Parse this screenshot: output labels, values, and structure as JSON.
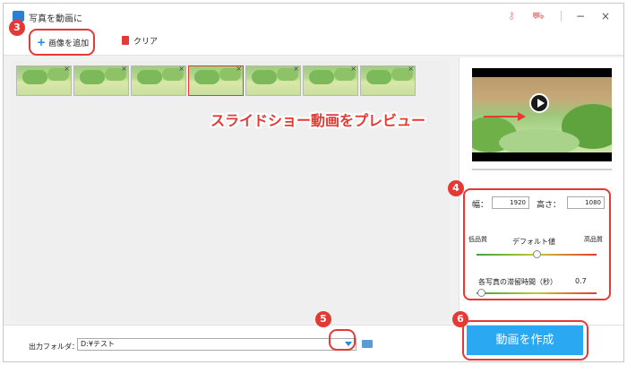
{
  "window": {
    "title": "写真を動画に",
    "key_icon": "key-icon",
    "cart_icon": "cart-icon",
    "minimize": "−",
    "close": "×"
  },
  "toolbar": {
    "add_label": "画像を追加",
    "clear_label": "クリア"
  },
  "thumbnails": [
    {
      "name": "photo-1",
      "selected": false
    },
    {
      "name": "photo-2",
      "selected": false
    },
    {
      "name": "photo-3",
      "selected": false
    },
    {
      "name": "photo-4",
      "selected": true
    },
    {
      "name": "photo-5",
      "selected": false
    },
    {
      "name": "photo-6",
      "selected": false
    },
    {
      "name": "photo-7",
      "selected": false
    }
  ],
  "preview": {
    "callout": "スライドショー動画をプレビュー"
  },
  "settings": {
    "width_label": "幅：",
    "width_value": "1920",
    "height_label": "高さ：",
    "height_value": "1080",
    "low_quality": "低品質",
    "default_value": "デフォルト値",
    "high_quality": "高品質",
    "quality_level": 0.5,
    "duration_label": "各写真の滞留時間（秒）",
    "duration_value": "0.7",
    "duration_level": 0.04
  },
  "output": {
    "folder_label": "出力フォルダ：",
    "folder_path": "D:¥テスト"
  },
  "create_button": "動画を作成",
  "badges": {
    "b3": "3",
    "b4": "4",
    "b5": "5",
    "b6": "6"
  },
  "colors": {
    "accent": "#2aa8f2",
    "highlight": "#e53935"
  }
}
